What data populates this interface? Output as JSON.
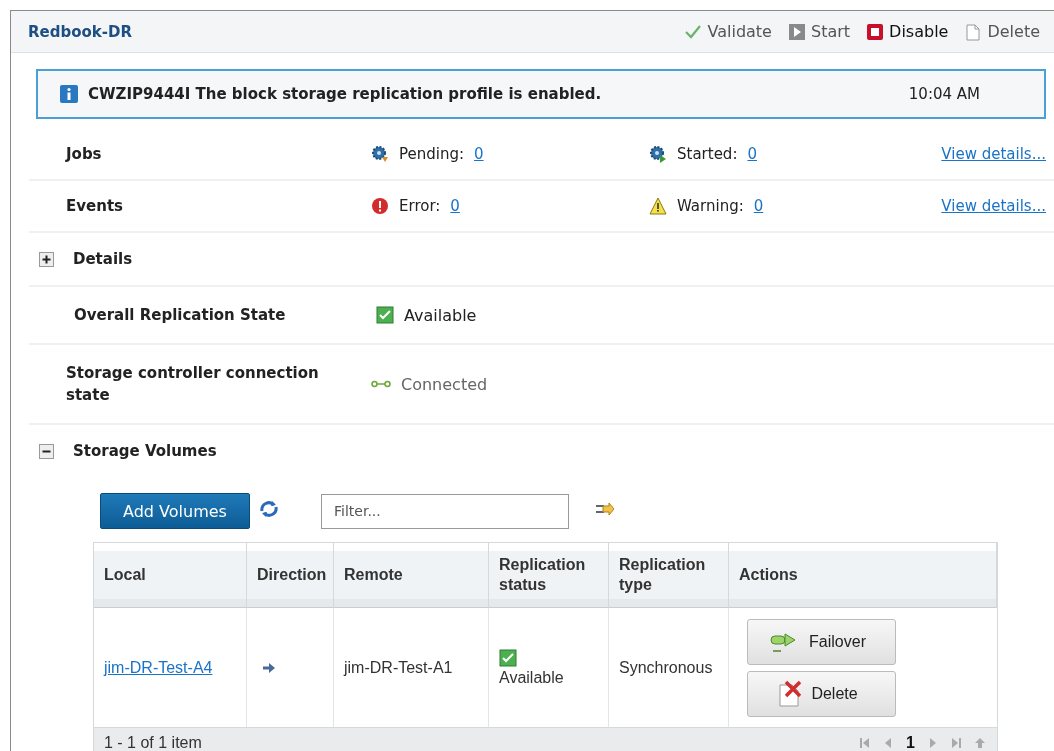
{
  "panel": {
    "title": "Redbook-DR",
    "actions": [
      {
        "kind": "validate",
        "label": "Validate"
      },
      {
        "kind": "start",
        "label": "Start"
      },
      {
        "kind": "disable",
        "label": "Disable"
      },
      {
        "kind": "delete",
        "label": "Delete"
      }
    ]
  },
  "message": {
    "text": "CWZIP9444I The block storage replication profile is enabled.",
    "time": "10:04 AM"
  },
  "summary": [
    {
      "label": "Jobs",
      "items": [
        {
          "kind": "pending",
          "label": "Pending:",
          "count": "0"
        },
        {
          "kind": "started",
          "label": "Started:",
          "count": "0"
        }
      ],
      "link": "View details..."
    },
    {
      "label": "Events",
      "items": [
        {
          "kind": "error",
          "label": "Error:",
          "count": "0"
        },
        {
          "kind": "warning",
          "label": "Warning:",
          "count": "0"
        }
      ],
      "link": "View details..."
    }
  ],
  "details": {
    "label": "Details",
    "expanded": false
  },
  "states": [
    {
      "label": "Overall Replication State",
      "kind": "available",
      "value": "Available"
    },
    {
      "label": "Storage controller connection state",
      "kind": "connected",
      "value": "Connected"
    }
  ],
  "volumes": {
    "label": "Storage Volumes",
    "expanded": true,
    "add_button": "Add Volumes",
    "filter_placeholder": "Filter...",
    "columns": [
      "Local",
      "Direction",
      "Remote",
      "Replication status",
      "Replication type",
      "Actions"
    ],
    "rows": [
      {
        "local": "jim-DR-Test-A4",
        "remote": "jim-DR-Test-A1",
        "status": "Available",
        "type": "Synchronous",
        "actions": [
          {
            "kind": "failover",
            "label": "Failover"
          },
          {
            "kind": "delete",
            "label": "Delete"
          }
        ]
      }
    ],
    "footer": "1 - 1 of 1 item",
    "page": "1"
  }
}
